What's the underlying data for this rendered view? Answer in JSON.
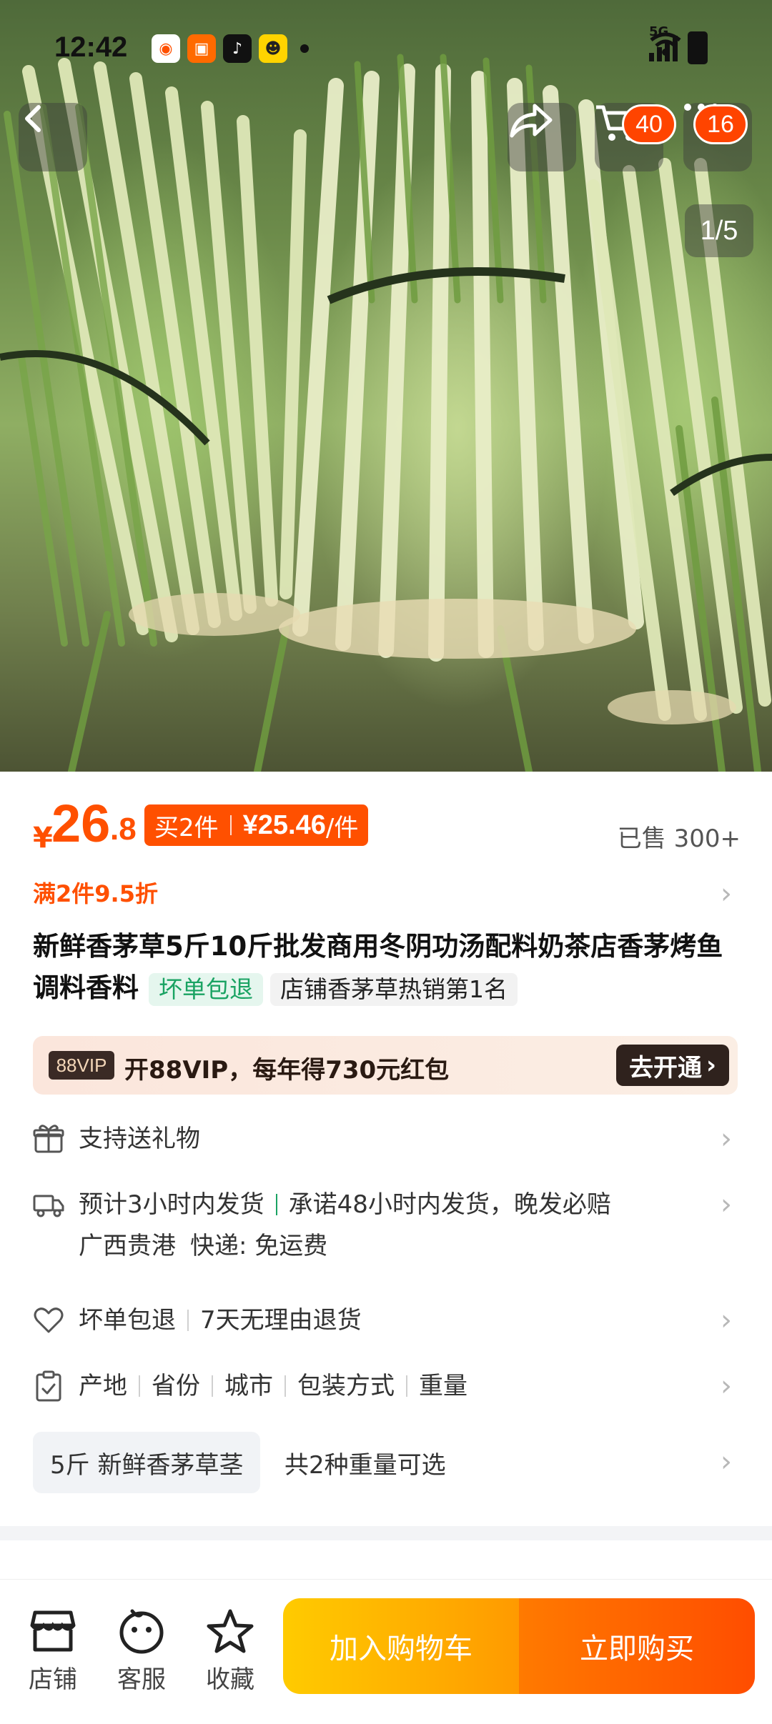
{
  "status_bar": {
    "time": "12:42",
    "network": "5G"
  },
  "header": {
    "cart_badge": "40",
    "more_badge": "16",
    "page_indicator": "1/5"
  },
  "product": {
    "price_symbol": "¥",
    "price_int": "26",
    "price_dec": ".8",
    "promo_label": "买2件",
    "promo_price": "¥25.46",
    "promo_unit": "/件",
    "sold": "已售 300+",
    "discount": "满2件9.5折",
    "title": "新鲜香茅草5斤10斤批发商用冬阴功汤配料奶茶店香茅烤鱼调料香料",
    "tag_green": "坏单包退",
    "tag_grey": "店铺香茅草热销第1名"
  },
  "vip": {
    "logo": "88VIP",
    "text": "开88VIP，每年得730元红包",
    "button": "去开通"
  },
  "services": {
    "gift": "支持送礼物",
    "shipping_estimate": "预计3小时内发货",
    "shipping_promise": "承诺48小时内发货，晚发必赔",
    "origin": "广西贵港",
    "express": "快递: 免运费",
    "guarantee_1": "坏单包退",
    "guarantee_2": "7天无理由退货",
    "params": [
      "产地",
      "省份",
      "城市",
      "包装方式",
      "重量"
    ],
    "spec_selected": "5斤 新鲜香茅草茎",
    "spec_more": "共2种重量可选"
  },
  "bottom_nav": {
    "shop": "店铺",
    "service": "客服",
    "favorite": "收藏",
    "add_cart": "加入购物车",
    "buy_now": "立即购买"
  },
  "colors": {
    "accent": "#ff5000",
    "green": "#1aa363"
  }
}
